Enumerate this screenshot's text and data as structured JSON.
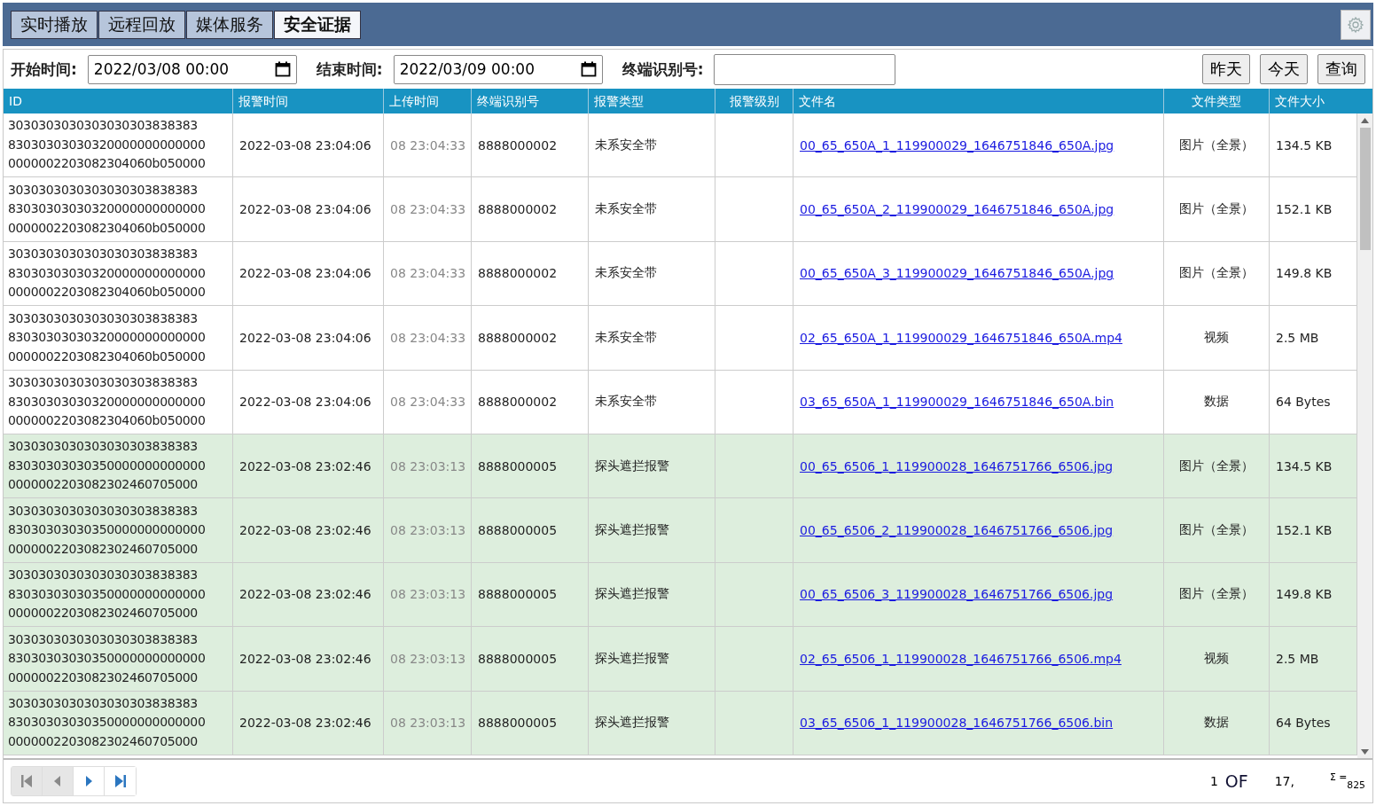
{
  "tabs": [
    {
      "label": "实时播放",
      "selected": false
    },
    {
      "label": "远程回放",
      "selected": false
    },
    {
      "label": "媒体服务",
      "selected": false
    },
    {
      "label": "安全证据",
      "selected": true
    }
  ],
  "filters": {
    "start_label": "开始时间:",
    "start_value": "2022/03/08 00:00",
    "end_label": "结束时间:",
    "end_value": "2022/03/09 00:00",
    "terminal_label": "终端识别号:",
    "buttons": [
      "昨天",
      "今天",
      "查询"
    ]
  },
  "table": {
    "columns": [
      "ID",
      "报警时间",
      "上传时间",
      "终端识别号",
      "报警类型",
      "报警级别",
      "文件名",
      "文件类型",
      "文件大小"
    ],
    "rows": [
      {
        "highlighted": false,
        "id_lines": [
          "3030303030303030303838383",
          "83030303030320000000000000",
          "0000002203082304060b050000"
        ],
        "alarm_time": "2022-03-08 23:04:06",
        "upload_time": "08 23:04:33",
        "terminal": "8888000002",
        "alarm_type": "未系安全带",
        "file_name": "00_65_650A_1_119900029_1646751846_650A.jpg",
        "file_type": "图片（全景）",
        "file_size": "134.5 KB"
      },
      {
        "highlighted": false,
        "id_lines": [
          "3030303030303030303838383",
          "83030303030320000000000000",
          "0000002203082304060b050000"
        ],
        "alarm_time": "2022-03-08 23:04:06",
        "upload_time": "08 23:04:33",
        "terminal": "8888000002",
        "alarm_type": "未系安全带",
        "file_name": "00_65_650A_2_119900029_1646751846_650A.jpg",
        "file_type": "图片（全景）",
        "file_size": "152.1 KB"
      },
      {
        "highlighted": false,
        "id_lines": [
          "3030303030303030303838383",
          "83030303030320000000000000",
          "0000002203082304060b050000"
        ],
        "alarm_time": "2022-03-08 23:04:06",
        "upload_time": "08 23:04:33",
        "terminal": "8888000002",
        "alarm_type": "未系安全带",
        "file_name": "00_65_650A_3_119900029_1646751846_650A.jpg",
        "file_type": "图片（全景）",
        "file_size": "149.8 KB"
      },
      {
        "highlighted": false,
        "id_lines": [
          "3030303030303030303838383",
          "83030303030320000000000000",
          "0000002203082304060b050000"
        ],
        "alarm_time": "2022-03-08 23:04:06",
        "upload_time": "08 23:04:33",
        "terminal": "8888000002",
        "alarm_type": "未系安全带",
        "file_name": "02_65_650A_1_119900029_1646751846_650A.mp4",
        "file_type": "视频",
        "file_size": "2.5 MB"
      },
      {
        "highlighted": false,
        "id_lines": [
          "3030303030303030303838383",
          "83030303030320000000000000",
          "0000002203082304060b050000"
        ],
        "alarm_time": "2022-03-08 23:04:06",
        "upload_time": "08 23:04:33",
        "terminal": "8888000002",
        "alarm_type": "未系安全带",
        "file_name": "03_65_650A_1_119900029_1646751846_650A.bin",
        "file_type": "数据",
        "file_size": "64 Bytes"
      },
      {
        "highlighted": true,
        "id_lines": [
          "3030303030303030303838383",
          "83030303030350000000000000",
          "0000002203082302460705000"
        ],
        "alarm_time": "2022-03-08 23:02:46",
        "upload_time": "08 23:03:13",
        "terminal": "8888000005",
        "alarm_type": "探头遮拦报警",
        "file_name": "00_65_6506_1_119900028_1646751766_6506.jpg",
        "file_type": "图片（全景）",
        "file_size": "134.5 KB"
      },
      {
        "highlighted": true,
        "id_lines": [
          "3030303030303030303838383",
          "83030303030350000000000000",
          "0000002203082302460705000"
        ],
        "alarm_time": "2022-03-08 23:02:46",
        "upload_time": "08 23:03:13",
        "terminal": "8888000005",
        "alarm_type": "探头遮拦报警",
        "file_name": "00_65_6506_2_119900028_1646751766_6506.jpg",
        "file_type": "图片（全景）",
        "file_size": "152.1 KB"
      },
      {
        "highlighted": true,
        "id_lines": [
          "3030303030303030303838383",
          "83030303030350000000000000",
          "0000002203082302460705000"
        ],
        "alarm_time": "2022-03-08 23:02:46",
        "upload_time": "08 23:03:13",
        "terminal": "8888000005",
        "alarm_type": "探头遮拦报警",
        "file_name": "00_65_6506_3_119900028_1646751766_6506.jpg",
        "file_type": "图片（全景）",
        "file_size": "149.8 KB"
      },
      {
        "highlighted": true,
        "id_lines": [
          "3030303030303030303838383",
          "83030303030350000000000000",
          "0000002203082302460705000"
        ],
        "alarm_time": "2022-03-08 23:02:46",
        "upload_time": "08 23:03:13",
        "terminal": "8888000005",
        "alarm_type": "探头遮拦报警",
        "file_name": "02_65_6506_1_119900028_1646751766_6506.mp4",
        "file_type": "视频",
        "file_size": "2.5 MB"
      },
      {
        "highlighted": true,
        "id_lines": [
          "3030303030303030303838383",
          "83030303030350000000000000",
          "0000002203082302460705000"
        ],
        "alarm_time": "2022-03-08 23:02:46",
        "upload_time": "08 23:03:13",
        "terminal": "8888000005",
        "alarm_type": "探头遮拦报警",
        "file_name": "03_65_6506_1_119900028_1646751766_6506.bin",
        "file_type": "数据",
        "file_size": "64 Bytes"
      }
    ]
  },
  "pager": {
    "buttons": [
      {
        "kind": "first",
        "disabled": true
      },
      {
        "kind": "prev",
        "disabled": true
      },
      {
        "kind": "next",
        "disabled": false
      },
      {
        "kind": "last",
        "disabled": false
      }
    ],
    "page": "1",
    "of_label": "OF",
    "pages": "17,",
    "total": "$^{Σ =}$$_{825}$"
  }
}
